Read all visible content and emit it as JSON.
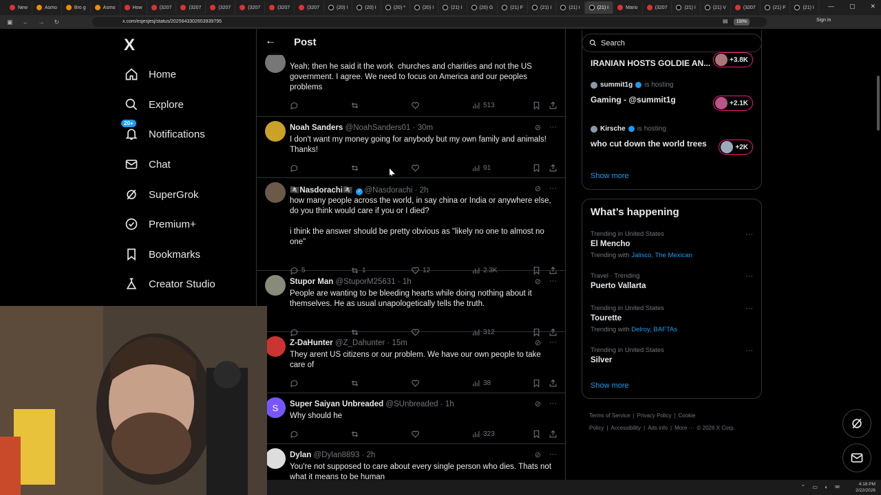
{
  "browser": {
    "tabs": [
      "New",
      "Asmo",
      "Bro g",
      "Asmo",
      "How",
      "(3207",
      "(3207",
      "(3207",
      "(3207",
      "(3207",
      "(3207",
      "(20) I",
      "(20) I",
      "(20) *",
      "(20) I",
      "(21) I",
      "(20) G",
      "(21) F",
      "(21) I",
      "(21) I",
      "(21) I",
      "Mario",
      "(3207",
      "(21) I",
      "(21) V",
      "(3207",
      "(21) F",
      "(21) I"
    ],
    "active_tab": "(21) I",
    "url": "x.com/esjesjesj/status/2025643302653939795",
    "zoom": "150%",
    "signin": "Sign in"
  },
  "nav": {
    "logo": "X",
    "items": [
      {
        "label": "Home",
        "icon": "home-icon"
      },
      {
        "label": "Explore",
        "icon": "search-icon"
      },
      {
        "label": "Notifications",
        "icon": "bell-icon",
        "badge": "20+"
      },
      {
        "label": "Chat",
        "icon": "mail-icon"
      },
      {
        "label": "SuperGrok",
        "icon": "grok-icon"
      },
      {
        "label": "Premium+",
        "icon": "verified-icon"
      },
      {
        "label": "Bookmarks",
        "icon": "bookmark-icon"
      },
      {
        "label": "Creator Studio",
        "icon": "creator-icon"
      }
    ]
  },
  "header": {
    "title": "Post"
  },
  "tweets": [
    {
      "name": "",
      "handle": "",
      "time": "",
      "verified": false,
      "text": "Yeah; then he said it the work  churches and charities and not the US government. I agree. We need to focus on America and our peoples problems",
      "replies": "",
      "reposts": "",
      "likes": "",
      "views": "513"
    },
    {
      "name": "Noah Sanders",
      "handle": "@NoahSanders01",
      "time": "30m",
      "verified": false,
      "text": "I don't want my money going for anybody but my own family and animals! Thanks!",
      "replies": "",
      "reposts": "",
      "likes": "",
      "views": "91"
    },
    {
      "name": "🏴‍☠️Nasdorachi🏴‍☠️",
      "handle": "@Nasdorachi",
      "time": "2h",
      "verified": true,
      "text": "how many people across the world, in say china or India or anywhere else, do you think would care if you or I died?\n\ni think the answer should be pretty obvious as \"likely no one to almost no one\"",
      "replies": "5",
      "reposts": "1",
      "likes": "12",
      "views": "2.3K"
    },
    {
      "name": "Stupor Man",
      "handle": "@StuporM25631",
      "time": "1h",
      "verified": false,
      "text": "People are wanting to be bleeding hearts while doing nothing about it themselves. He as usual unapologetically tells the truth.",
      "replies": "",
      "reposts": "",
      "likes": "",
      "views": "312"
    },
    {
      "name": "Z-DaHunter",
      "handle": "@Z_Dahunter",
      "time": "15m",
      "verified": false,
      "text": "They arent US citizens or our problem. We have our own people to take care of",
      "replies": "",
      "reposts": "",
      "likes": "",
      "views": "38"
    },
    {
      "name": "Super Saiyan Unbreaded",
      "handle": "@SUnbreaded",
      "time": "1h",
      "verified": false,
      "text": "Why should he",
      "replies": "",
      "reposts": "",
      "likes": "",
      "views": "323",
      "initial": "S"
    },
    {
      "name": "Dylan",
      "handle": "@Dylan8893",
      "time": "2h",
      "verified": false,
      "text": "You're not supposed to care about every single person who dies. Thats not what it means to be human",
      "replies": "",
      "reposts": "",
      "likes": "",
      "views": ""
    }
  ],
  "search": {
    "placeholder": "Search"
  },
  "live": {
    "items": [
      {
        "host": "",
        "title": "IRANIAN HOSTS GOLDIE AN...",
        "count": "+3.8K"
      },
      {
        "host": "summit1g",
        "status": "is hosting",
        "title": "Gaming - @summit1g",
        "count": "+2.1K"
      },
      {
        "host": "Kirsche",
        "status": "is hosting",
        "title": "who cut down the world trees",
        "count": "+2K"
      }
    ],
    "show_more": "Show more"
  },
  "happening": {
    "title": "What’s happening",
    "trends": [
      {
        "meta": "Trending in United States",
        "name": "El Mencho",
        "with_label": "Trending with",
        "with_links": "Jalisco, The Mexican"
      },
      {
        "meta": "Travel · Trending",
        "name": "Puerto Vallarta",
        "with_label": "",
        "with_links": ""
      },
      {
        "meta": "Trending in United States",
        "name": "Tourette",
        "with_label": "Trending with",
        "with_links": "Delroy, BAFTAs"
      },
      {
        "meta": "Trending in United States",
        "name": "Silver",
        "with_label": "",
        "with_links": ""
      }
    ],
    "show_more": "Show more"
  },
  "footer": {
    "links": [
      "Terms of Service",
      "|",
      "Privacy Policy",
      "|",
      "Cookie Policy",
      "|",
      "Accessibility",
      "|",
      "Ads info",
      "|",
      "More ···",
      "© 2026 X Corp."
    ]
  },
  "taskbar": {
    "time": "4:18 PM",
    "date": "2/22/2026"
  }
}
